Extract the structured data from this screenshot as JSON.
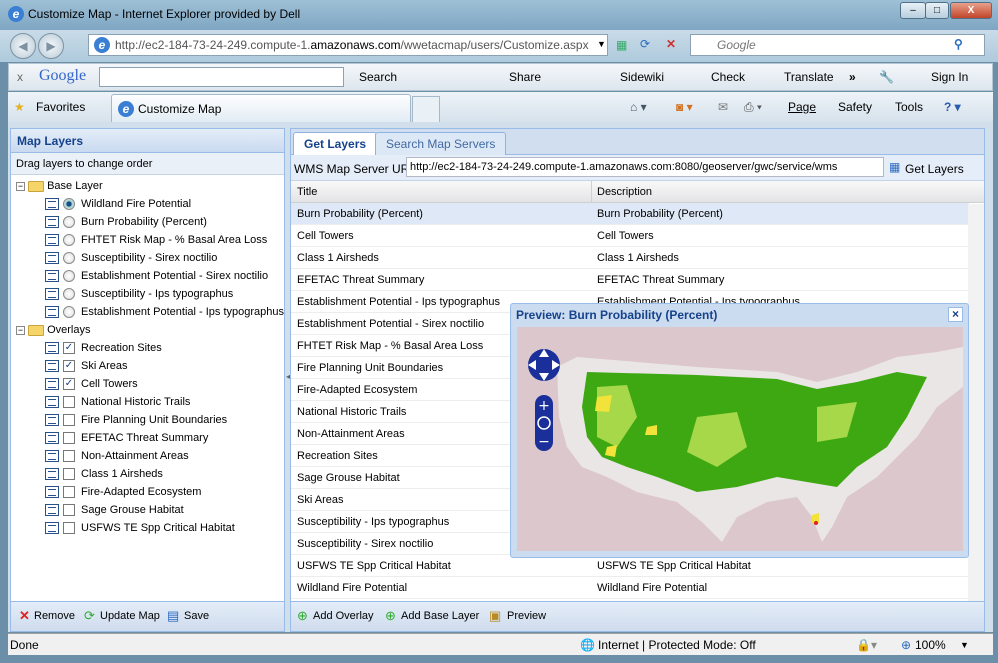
{
  "window": {
    "title": "Customize Map - Internet Explorer provided by Dell",
    "min": "–",
    "max": "□",
    "close": "X"
  },
  "address": {
    "url_prefix": "http://ec2-184-73-24-249.compute-1.",
    "url_domain": "amazonaws.com",
    "url_suffix": "/wwetacmap/users/Customize.aspx",
    "search_placeholder": "Google"
  },
  "google_toolbar": {
    "close": "x",
    "logo": "Google",
    "search": "Search",
    "share": "Share",
    "sidewiki": "Sidewiki",
    "check": "Check",
    "translate": "Translate",
    "more": "»",
    "signin": "Sign In"
  },
  "favorites_bar": {
    "favorites": "Favorites",
    "tab_title": "Customize Map",
    "page": "Page",
    "safety": "Safety",
    "tools": "Tools"
  },
  "left_panel": {
    "title": "Map Layers",
    "hint": "Drag layers to change order",
    "groups": [
      {
        "label": "Base Layer",
        "type": "radio",
        "items": [
          {
            "label": "Wildland Fire Potential",
            "checked": true
          },
          {
            "label": "Burn Probability (Percent)",
            "checked": false
          },
          {
            "label": "FHTET Risk Map - % Basal Area Loss",
            "checked": false
          },
          {
            "label": "Susceptibility - Sirex noctilio",
            "checked": false
          },
          {
            "label": "Establishment Potential - Sirex noctilio",
            "checked": false
          },
          {
            "label": "Susceptibility - Ips typographus",
            "checked": false
          },
          {
            "label": "Establishment Potential - Ips typographus",
            "checked": false
          }
        ]
      },
      {
        "label": "Overlays",
        "type": "checkbox",
        "items": [
          {
            "label": "Recreation Sites",
            "checked": true
          },
          {
            "label": "Ski Areas",
            "checked": true
          },
          {
            "label": "Cell Towers",
            "checked": true
          },
          {
            "label": "National Historic Trails",
            "checked": false
          },
          {
            "label": "Fire Planning Unit Boundaries",
            "checked": false
          },
          {
            "label": "EFETAC Threat Summary",
            "checked": false
          },
          {
            "label": "Non-Attainment Areas",
            "checked": false
          },
          {
            "label": "Class 1 Airsheds",
            "checked": false
          },
          {
            "label": "Fire-Adapted Ecosystem",
            "checked": false
          },
          {
            "label": "Sage Grouse Habitat",
            "checked": false
          },
          {
            "label": "USFWS TE Spp Critical Habitat",
            "checked": false
          }
        ]
      }
    ],
    "footer": {
      "remove": "Remove",
      "update": "Update Map",
      "save": "Save"
    }
  },
  "right_panel": {
    "tabs": [
      {
        "label": "Get Layers",
        "active": true
      },
      {
        "label": "Search Map Servers",
        "active": false
      }
    ],
    "url_label": "WMS Map Server URL:",
    "url_value": "http://ec2-184-73-24-249.compute-1.amazonaws.com:8080/geoserver/gwc/service/wms",
    "get_layers": "Get Layers",
    "columns": [
      "Title",
      "Description"
    ],
    "rows": [
      [
        "Burn Probability (Percent)",
        "Burn Probability (Percent)"
      ],
      [
        "Cell Towers",
        "Cell Towers"
      ],
      [
        "Class 1 Airsheds",
        "Class 1 Airsheds"
      ],
      [
        "EFETAC Threat Summary",
        "EFETAC Threat Summary"
      ],
      [
        "Establishment Potential - Ips typographus",
        "Establishment Potential - Ips typographus"
      ],
      [
        "Establishment Potential - Sirex noctilio",
        ""
      ],
      [
        "FHTET Risk Map - % Basal Area Loss",
        ""
      ],
      [
        "Fire Planning Unit Boundaries",
        ""
      ],
      [
        "Fire-Adapted Ecosystem",
        ""
      ],
      [
        "National Historic Trails",
        ""
      ],
      [
        "Non-Attainment Areas",
        ""
      ],
      [
        "Recreation Sites",
        ""
      ],
      [
        "Sage Grouse Habitat",
        ""
      ],
      [
        "Ski Areas",
        ""
      ],
      [
        "Susceptibility - Ips typographus",
        ""
      ],
      [
        "Susceptibility - Sirex noctilio",
        ""
      ],
      [
        "USFWS TE Spp Critical Habitat",
        "USFWS TE Spp Critical Habitat"
      ],
      [
        "Wildland Fire Potential",
        "Wildland Fire Potential"
      ]
    ],
    "selected_row": 0,
    "footer": {
      "add_overlay": "Add Overlay",
      "add_base": "Add Base Layer",
      "preview": "Preview"
    }
  },
  "preview": {
    "title": "Preview: Burn Probability (Percent)",
    "close": "×"
  },
  "status": {
    "text": "Done",
    "zone": "Internet | Protected Mode: Off",
    "zoom": "100%"
  }
}
